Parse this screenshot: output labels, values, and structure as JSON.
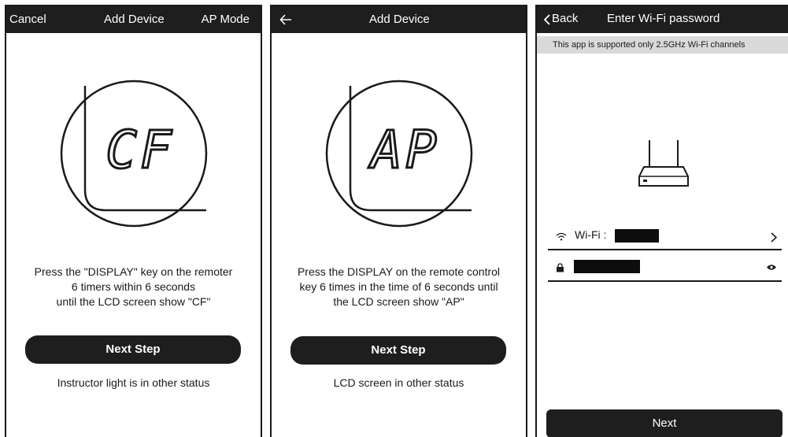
{
  "screens": [
    {
      "topbar": {
        "left": "Cancel",
        "title": "Add Device",
        "right": "AP Mode"
      },
      "lcd_text": "CF",
      "instructions": [
        "Press the \"DISPLAY\" key on the remoter",
        "6 timers within 6 seconds",
        "until the LCD screen show \"CF\""
      ],
      "next_label": "Next Step",
      "other_link": "Instructor light is in other status"
    },
    {
      "topbar": {
        "back_icon": "arrow-left-icon",
        "title": "Add Device"
      },
      "lcd_text": "AP",
      "instructions": [
        "Press the DISPLAY on the remote control",
        "key 6 times in the time of 6 seconds until",
        "the LCD screen show \"AP\""
      ],
      "next_label": "Next Step",
      "other_link": "LCD screen in other status"
    },
    {
      "topbar": {
        "back_label": "Back",
        "title": "Enter Wi-Fi password"
      },
      "notice": "This app is supported only 2.5GHz Wi-Fi channels",
      "wifi_label": "Wi-Fi :",
      "next_label": "Next",
      "icons": [
        "router-icon",
        "wifi-icon",
        "chevron-right-icon",
        "lock-icon",
        "eye-icon"
      ]
    }
  ],
  "colors": {
    "bar": "#1e1e1e",
    "notice_bg": "#d9d9d9",
    "text": "#1a1a1a"
  }
}
